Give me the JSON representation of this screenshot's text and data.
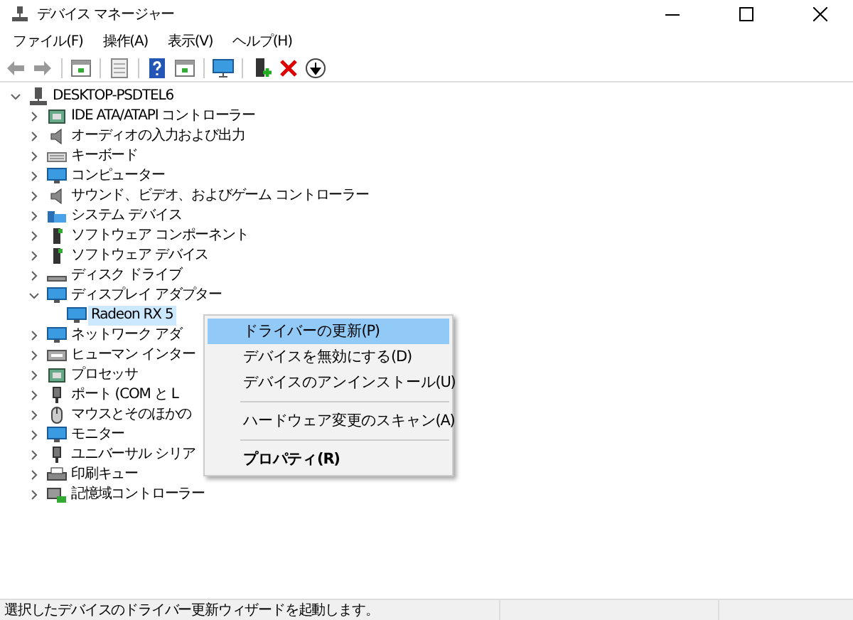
{
  "window": {
    "title": "デバイス マネージャー"
  },
  "menu_bar": [
    "ファイル(F)",
    "操作(A)",
    "表示(V)",
    "ヘルプ(H)"
  ],
  "tree": {
    "label": "DESKTOP-PSDTEL6",
    "expanded": true,
    "selected": false,
    "children": [
      {
        "label": "IDE ATA/ATAPI コントローラー",
        "expanded": false,
        "selected": false
      },
      {
        "label": "オーディオの入力および出力",
        "expanded": false,
        "selected": false
      },
      {
        "label": "キーボード",
        "expanded": false,
        "selected": false
      },
      {
        "label": "コンピューター",
        "expanded": false,
        "selected": false
      },
      {
        "label": "サウンド、ビデオ、およびゲーム コントローラー",
        "expanded": false,
        "selected": false
      },
      {
        "label": "システム デバイス",
        "expanded": false,
        "selected": false
      },
      {
        "label": "ソフトウェア コンポーネント",
        "expanded": false,
        "selected": false
      },
      {
        "label": "ソフトウェア デバイス",
        "expanded": false,
        "selected": false
      },
      {
        "label": "ディスク ドライブ",
        "expanded": false,
        "selected": false
      },
      {
        "label": "ディスプレイ アダプター",
        "expanded": true,
        "selected": false,
        "children": [
          {
            "label": "Radeon RX 5",
            "selected": true
          }
        ]
      },
      {
        "label": "ネットワーク アダ",
        "expanded": false,
        "selected": false
      },
      {
        "label": "ヒューマン インター",
        "expanded": false,
        "selected": false
      },
      {
        "label": "プロセッサ",
        "expanded": false,
        "selected": false
      },
      {
        "label": "ポート (COM と L",
        "expanded": false,
        "selected": false
      },
      {
        "label": "マウスとそのほかの",
        "expanded": false,
        "selected": false
      },
      {
        "label": "モニター",
        "expanded": false,
        "selected": false
      },
      {
        "label": "ユニバーサル シリア",
        "expanded": false,
        "selected": false
      },
      {
        "label": "印刷キュー",
        "expanded": false,
        "selected": false
      },
      {
        "label": "記憶域コントローラー",
        "expanded": false,
        "selected": false
      }
    ]
  },
  "context_menu": [
    {
      "kind": "item",
      "label": "ドライバーの更新(P)",
      "selected": true,
      "default": false
    },
    {
      "kind": "item",
      "label": "デバイスを無効にする(D)",
      "selected": false,
      "default": false
    },
    {
      "kind": "item",
      "label": "デバイスのアンインストール(U)",
      "selected": false,
      "default": false
    },
    {
      "kind": "separator"
    },
    {
      "kind": "item",
      "label": "ハードウェア変更のスキャン(A)",
      "selected": false,
      "default": false
    },
    {
      "kind": "separator"
    },
    {
      "kind": "item",
      "label": "プロパティ(R)",
      "selected": false,
      "default": true
    }
  ],
  "status_bar": {
    "text": "選択したデバイスのドライバー更新ウィザードを起動します。"
  }
}
